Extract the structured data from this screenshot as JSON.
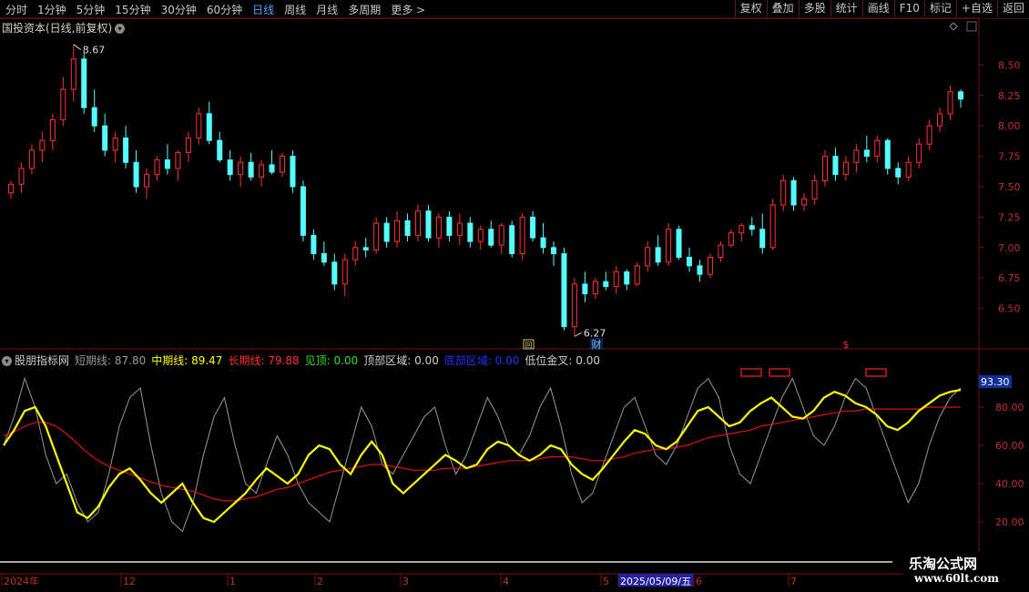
{
  "toolbar": {
    "periods": [
      "分时",
      "1分钟",
      "5分钟",
      "15分钟",
      "30分钟",
      "60分钟",
      "日线",
      "周线",
      "月线",
      "多周期",
      "更多 >"
    ],
    "active_period": "日线",
    "actions": [
      "复权",
      "叠加",
      "多股",
      "统计",
      "画线",
      "F10",
      "标记",
      "+自选",
      "返回"
    ]
  },
  "chart": {
    "title": "国投资本(日线,前复权)",
    "high_label": "8.67",
    "low_label": "6.27",
    "price_ticks": [
      "8.50",
      "8.25",
      "8.00",
      "7.75",
      "7.50",
      "7.25",
      "7.00",
      "6.75",
      "6.50"
    ],
    "markers": {
      "cai": "财",
      "dollar": "$",
      "box": "回"
    }
  },
  "indicator": {
    "name": "股朋指标网",
    "short_label": "短期线: 87.80",
    "mid_label": "中期线: 89.47",
    "long_label": "长期线: 79.88",
    "jianding_label": "见顶: 0.00",
    "top_zone_label": "顶部区域: 0.00",
    "bottom_zone_label": "底部区域: 0.00",
    "golden_cross_label": "低位金叉: 0.00",
    "ticks": [
      "80.00",
      "60.00",
      "40.00",
      "20.00"
    ],
    "current_value": "93.30",
    "short_color": "#9a9a9a",
    "mid_color": "#ffff00",
    "long_color": "#e01010"
  },
  "timeline": {
    "labels": [
      "2024年",
      "12",
      "1",
      "2",
      "3",
      "4",
      "5",
      "2025/05/09/五",
      "6",
      "7"
    ]
  },
  "watermark": {
    "line1": "乐淘公式网",
    "line2": "www.60lt.com"
  },
  "colors": {
    "up": "#ff3232",
    "down": "#54ffff",
    "grid": "#7a1010",
    "axis_text": "#c03030"
  },
  "chart_data": {
    "type": "candlestick",
    "candles": [
      [
        7.45,
        7.55,
        7.4,
        7.52
      ],
      [
        7.52,
        7.7,
        7.45,
        7.65
      ],
      [
        7.65,
        7.85,
        7.6,
        7.8
      ],
      [
        7.8,
        7.95,
        7.7,
        7.88
      ],
      [
        7.88,
        8.1,
        7.8,
        8.05
      ],
      [
        8.05,
        8.4,
        8.0,
        8.3
      ],
      [
        8.3,
        8.67,
        8.2,
        8.55
      ],
      [
        8.55,
        8.6,
        8.1,
        8.15
      ],
      [
        8.15,
        8.3,
        7.95,
        8.0
      ],
      [
        8.0,
        8.1,
        7.75,
        7.8
      ],
      [
        7.8,
        7.95,
        7.7,
        7.9
      ],
      [
        7.9,
        8.0,
        7.65,
        7.7
      ],
      [
        7.7,
        7.8,
        7.45,
        7.5
      ],
      [
        7.5,
        7.65,
        7.4,
        7.6
      ],
      [
        7.6,
        7.75,
        7.55,
        7.72
      ],
      [
        7.72,
        7.85,
        7.6,
        7.65
      ],
      [
        7.65,
        7.8,
        7.55,
        7.78
      ],
      [
        7.78,
        7.95,
        7.7,
        7.9
      ],
      [
        7.9,
        8.15,
        7.85,
        8.1
      ],
      [
        8.1,
        8.2,
        7.85,
        7.88
      ],
      [
        7.88,
        7.95,
        7.7,
        7.72
      ],
      [
        7.72,
        7.8,
        7.55,
        7.6
      ],
      [
        7.6,
        7.75,
        7.5,
        7.7
      ],
      [
        7.7,
        7.78,
        7.55,
        7.58
      ],
      [
        7.58,
        7.72,
        7.5,
        7.68
      ],
      [
        7.68,
        7.8,
        7.6,
        7.62
      ],
      [
        7.62,
        7.78,
        7.58,
        7.75
      ],
      [
        7.75,
        7.8,
        7.45,
        7.5
      ],
      [
        7.5,
        7.55,
        7.05,
        7.1
      ],
      [
        7.1,
        7.15,
        6.9,
        6.95
      ],
      [
        6.95,
        7.05,
        6.85,
        6.88
      ],
      [
        6.88,
        6.95,
        6.65,
        6.7
      ],
      [
        6.7,
        6.95,
        6.6,
        6.9
      ],
      [
        6.9,
        7.05,
        6.85,
        7.0
      ],
      [
        7.0,
        7.08,
        6.92,
        6.98
      ],
      [
        6.98,
        7.25,
        6.95,
        7.2
      ],
      [
        7.2,
        7.25,
        7.0,
        7.05
      ],
      [
        7.05,
        7.3,
        7.0,
        7.22
      ],
      [
        7.22,
        7.28,
        7.05,
        7.1
      ],
      [
        7.1,
        7.35,
        7.05,
        7.3
      ],
      [
        7.3,
        7.35,
        7.05,
        7.08
      ],
      [
        7.08,
        7.28,
        7.0,
        7.25
      ],
      [
        7.25,
        7.3,
        7.05,
        7.1
      ],
      [
        7.1,
        7.28,
        7.02,
        7.2
      ],
      [
        7.2,
        7.25,
        7.0,
        7.05
      ],
      [
        7.05,
        7.18,
        6.98,
        7.15
      ],
      [
        7.15,
        7.22,
        7.0,
        7.02
      ],
      [
        7.02,
        7.2,
        6.95,
        7.18
      ],
      [
        7.18,
        7.22,
        6.92,
        6.95
      ],
      [
        6.95,
        7.28,
        6.9,
        7.25
      ],
      [
        7.25,
        7.3,
        7.05,
        7.08
      ],
      [
        7.08,
        7.2,
        6.95,
        7.0
      ],
      [
        7.0,
        7.05,
        6.85,
        6.95
      ],
      [
        6.95,
        7.0,
        6.32,
        6.35
      ],
      [
        6.35,
        6.75,
        6.27,
        6.7
      ],
      [
        6.7,
        6.8,
        6.55,
        6.62
      ],
      [
        6.62,
        6.75,
        6.58,
        6.72
      ],
      [
        6.72,
        6.8,
        6.65,
        6.68
      ],
      [
        6.68,
        6.85,
        6.62,
        6.8
      ],
      [
        6.8,
        6.82,
        6.65,
        6.7
      ],
      [
        6.7,
        6.88,
        6.68,
        6.85
      ],
      [
        6.85,
        7.05,
        6.8,
        7.0
      ],
      [
        7.0,
        7.1,
        6.85,
        6.88
      ],
      [
        6.88,
        7.2,
        6.85,
        7.15
      ],
      [
        7.15,
        7.18,
        6.9,
        6.92
      ],
      [
        6.92,
        7.0,
        6.8,
        6.85
      ],
      [
        6.85,
        6.9,
        6.72,
        6.78
      ],
      [
        6.78,
        6.95,
        6.75,
        6.92
      ],
      [
        6.92,
        7.05,
        6.88,
        7.02
      ],
      [
        7.02,
        7.15,
        7.0,
        7.12
      ],
      [
        7.12,
        7.2,
        7.05,
        7.18
      ],
      [
        7.18,
        7.25,
        7.1,
        7.15
      ],
      [
        7.15,
        7.28,
        6.95,
        7.0
      ],
      [
        7.0,
        7.4,
        6.98,
        7.35
      ],
      [
        7.35,
        7.6,
        7.3,
        7.55
      ],
      [
        7.55,
        7.58,
        7.3,
        7.35
      ],
      [
        7.35,
        7.45,
        7.3,
        7.4
      ],
      [
        7.4,
        7.6,
        7.35,
        7.55
      ],
      [
        7.55,
        7.8,
        7.5,
        7.75
      ],
      [
        7.75,
        7.82,
        7.55,
        7.6
      ],
      [
        7.6,
        7.75,
        7.55,
        7.7
      ],
      [
        7.7,
        7.85,
        7.62,
        7.8
      ],
      [
        7.8,
        7.92,
        7.7,
        7.75
      ],
      [
        7.75,
        7.92,
        7.7,
        7.88
      ],
      [
        7.88,
        7.9,
        7.6,
        7.65
      ],
      [
        7.65,
        7.7,
        7.52,
        7.58
      ],
      [
        7.58,
        7.75,
        7.55,
        7.7
      ],
      [
        7.7,
        7.9,
        7.65,
        7.85
      ],
      [
        7.85,
        8.05,
        7.8,
        8.0
      ],
      [
        8.0,
        8.15,
        7.95,
        8.1
      ],
      [
        8.1,
        8.33,
        8.05,
        8.28
      ],
      [
        8.28,
        8.3,
        8.15,
        8.22
      ]
    ],
    "ylim": [
      6.25,
      8.75
    ],
    "indicator_series": {
      "short": [
        60,
        75,
        95,
        80,
        55,
        40,
        45,
        30,
        20,
        25,
        45,
        70,
        85,
        90,
        60,
        35,
        20,
        15,
        30,
        55,
        75,
        85,
        60,
        40,
        35,
        50,
        65,
        55,
        40,
        30,
        25,
        20,
        40,
        60,
        80,
        70,
        50,
        45,
        55,
        65,
        75,
        80,
        60,
        45,
        55,
        70,
        85,
        75,
        60,
        55,
        65,
        80,
        90,
        70,
        45,
        30,
        35,
        50,
        65,
        80,
        85,
        70,
        55,
        50,
        60,
        75,
        90,
        95,
        85,
        60,
        45,
        40,
        55,
        70,
        85,
        95,
        80,
        65,
        60,
        70,
        85,
        95,
        90,
        75,
        60,
        45,
        30,
        40,
        60,
        75,
        85,
        90
      ],
      "mid": [
        60,
        68,
        78,
        80,
        70,
        55,
        40,
        25,
        22,
        28,
        38,
        45,
        48,
        42,
        35,
        30,
        35,
        40,
        30,
        22,
        20,
        25,
        30,
        35,
        42,
        48,
        44,
        40,
        45,
        55,
        60,
        58,
        50,
        45,
        55,
        62,
        55,
        40,
        35,
        40,
        45,
        50,
        55,
        52,
        48,
        50,
        58,
        62,
        60,
        55,
        52,
        55,
        60,
        58,
        50,
        45,
        42,
        48,
        55,
        62,
        68,
        66,
        60,
        58,
        62,
        70,
        78,
        80,
        75,
        70,
        72,
        78,
        82,
        85,
        80,
        75,
        74,
        78,
        85,
        88,
        86,
        82,
        80,
        76,
        70,
        68,
        72,
        78,
        82,
        86,
        88,
        89
      ],
      "long": [
        65,
        67,
        70,
        72,
        72,
        70,
        66,
        61,
        56,
        52,
        49,
        47,
        45,
        43,
        41,
        39,
        38,
        37,
        36,
        34,
        32,
        31,
        31,
        32,
        33,
        35,
        37,
        38,
        40,
        42,
        44,
        46,
        47,
        48,
        49,
        50,
        50,
        49,
        48,
        47,
        47,
        47,
        48,
        48,
        48,
        49,
        50,
        51,
        52,
        52,
        52,
        53,
        54,
        54,
        54,
        53,
        52,
        52,
        53,
        54,
        56,
        57,
        58,
        58,
        59,
        60,
        62,
        64,
        65,
        66,
        67,
        68,
        70,
        71,
        72,
        73,
        74,
        75,
        76,
        77,
        78,
        78,
        79,
        79,
        79,
        79,
        79,
        79,
        80,
        80,
        80,
        80
      ]
    }
  }
}
